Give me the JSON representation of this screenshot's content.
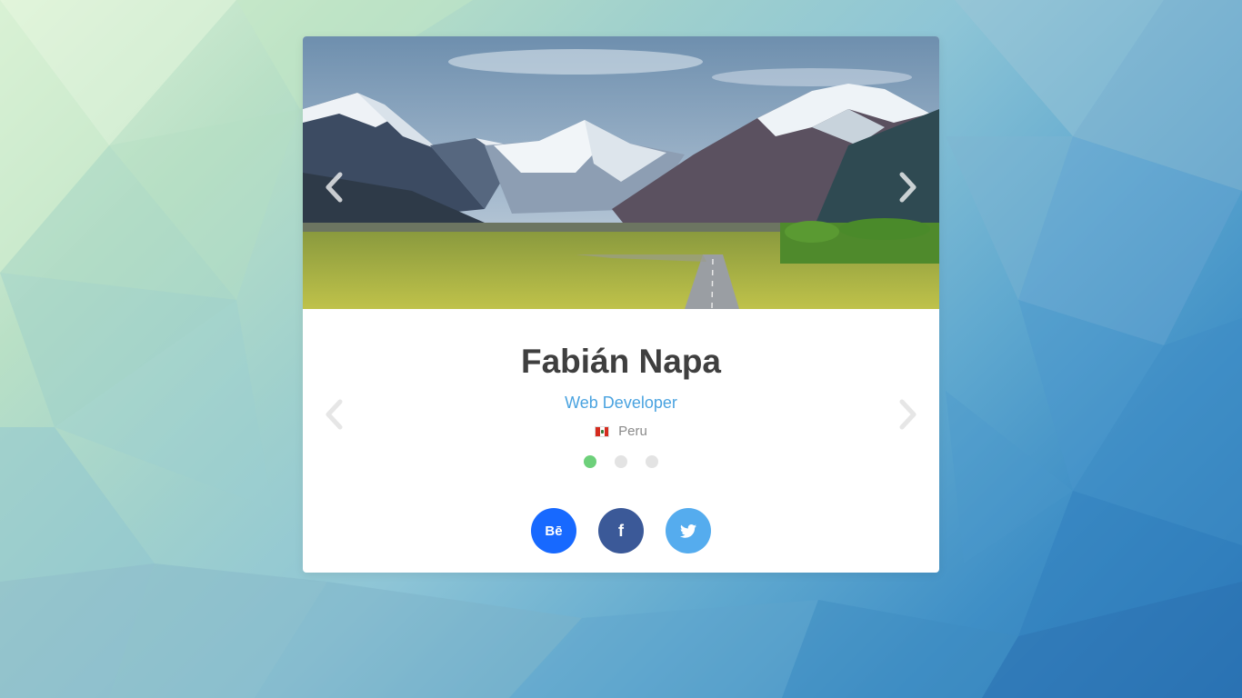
{
  "profile": {
    "name": "Fabián Napa",
    "role": "Web Developer",
    "country": "Peru"
  },
  "carousel": {
    "slides": 3,
    "active_index": 0
  },
  "social": {
    "behance_label": "Bē",
    "facebook_label": "f"
  },
  "icons": {
    "prev": "chevron-left-icon",
    "next": "chevron-right-icon",
    "flag": "peru-flag-icon",
    "twitter": "twitter-icon"
  },
  "colors": {
    "accent_role": "#4aa3e0",
    "dot_active": "#6dd07a",
    "dot_inactive": "#e3e3e3",
    "behance": "#1769ff",
    "facebook": "#3b5998",
    "twitter": "#55acee"
  }
}
